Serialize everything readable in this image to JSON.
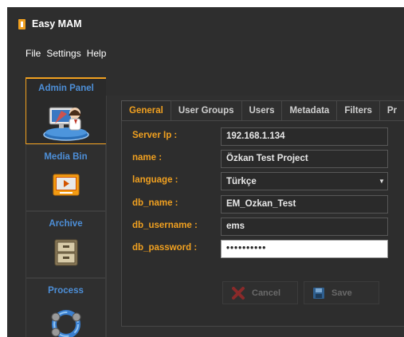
{
  "app": {
    "title": "Easy MAM"
  },
  "menu": [
    "File",
    "Settings",
    "Help"
  ],
  "sidebar": {
    "items": [
      {
        "label": "Admin Panel",
        "icon": "admin-panel-icon"
      },
      {
        "label": "Media Bin",
        "icon": "media-bin-icon"
      },
      {
        "label": "Archive",
        "icon": "archive-icon"
      },
      {
        "label": "Process",
        "icon": "process-icon"
      }
    ]
  },
  "tabs": [
    "General",
    "User Groups",
    "Users",
    "Metadata",
    "Filters",
    "Pr"
  ],
  "form": {
    "server_ip": {
      "label": "Server Ip :",
      "value": "192.168.1.134"
    },
    "name": {
      "label": "name :",
      "value": "Özkan Test Project"
    },
    "language": {
      "label": "language :",
      "value": "Türkçe"
    },
    "db_name": {
      "label": "db_name :",
      "value": "EM_Ozkan_Test"
    },
    "db_username": {
      "label": "db_username :",
      "value": "ems"
    },
    "db_password": {
      "label": "db_password :",
      "value": "••••••••••"
    }
  },
  "buttons": {
    "cancel": "Cancel",
    "save": "Save"
  },
  "colors": {
    "accent": "#f0a020",
    "sidebar_label": "#4d8fd8",
    "background": "#2e2e2e"
  }
}
